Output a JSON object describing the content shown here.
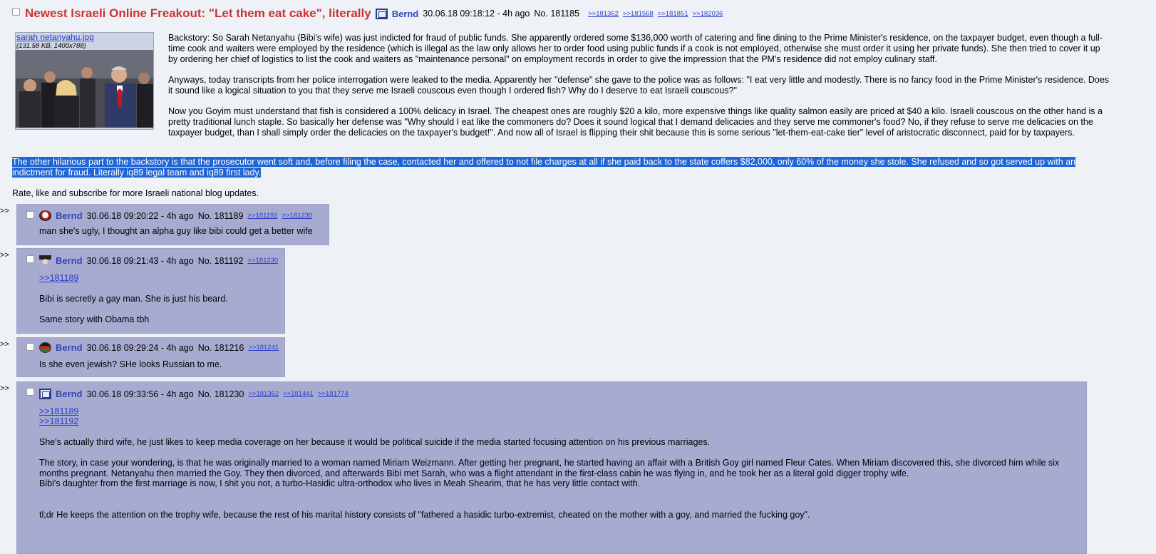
{
  "op": {
    "subject": "Newest Israeli Online Freakout: \"Let them eat cake\", literally",
    "name": "Bernd",
    "datetime": "30.06.18 09:18:12 - 4h ago",
    "number": "No. 181185",
    "backlinks": [
      ">>181362",
      ">>181568",
      ">>181851",
      ">>182036"
    ],
    "file_name": "sarah netanyahu.jpg",
    "file_info": "(131.58 KB, 1400x788)",
    "paragraphs": [
      "Backstory: So Sarah Netanyahu (Bibi's wife) was just indicted for fraud of public funds. She apparently ordered some $136,000 worth of catering and fine dining to the Prime Minister's residence, on the taxpayer budget, even though a full-time cook and waiters were employed by the residence (which is illegal as the law only allows her to order food using public funds if a cook is not employed, otherwise she must order it using her private funds). She then tried to cover it up by ordering her chief of logistics to list the cook and waiters as \"maintenance personal\" on employment records in order to give the impression that the PM's residence did not employ culinary staff.",
      "Anyways, today transcripts from her police interrogation were leaked to the media. Apparently her \"defense\" she gave to the police was as follows: \"I eat very little and modestly. There is no fancy food in the Prime Minister's residence. Does it sound like a logical situation to you that they serve me Israeli couscous even though I ordered fish? Why do I deserve to eat Israeli couscous?\"",
      "Now you Goyim must understand that fish is considered a 100% delicacy in Israel. The cheapest ones are roughly $20 a kilo, more expensive things like quality salmon easily are priced at $40 a kilo. Israeli couscous on the other hand is a pretty traditional lunch staple. So basically her defense was \"Why should I eat like the commoners do? Does it sound logical that I demand delicacies and they serve me commoner's food? No, if they refuse to serve me delicacies on the taxpayer budget, than I shall simply order the delicacies on the taxpayer's budget!\". And now all of Israel is flipping their shit because this is some serious \"let-them-eat-cake tier\" level of aristocratic disconnect, paid for by taxpayers."
    ],
    "highlighted": "The other hilarious part to the backstory is that the prosecutor went soft and, before filing the case, contacted her and offered to not file charges at all if she paid back to the state coffers $82,000, only 60% of the money she stole. She refused and so got served up with an indictment for fraud. Literally iq89 legal team and iq89 first lady.",
    "closing": "Rate, like and subscribe for more Israeli national blog updates."
  },
  "arrow": ">>",
  "replies": [
    {
      "name": "Bernd",
      "datetime": "30.06.18 09:20:22 - 4h ago",
      "number": "No. 181189",
      "backlinks": [
        ">>181192",
        ">>181230"
      ],
      "quotes": [],
      "paragraphs": [
        "man she's ugly, I thought an alpha guy like bibi could get a better wife"
      ]
    },
    {
      "name": "Bernd",
      "datetime": "30.06.18 09:21:43 - 4h ago",
      "number": "No. 181192",
      "backlinks": [
        ">>181230"
      ],
      "quotes": [
        ">>181189"
      ],
      "paragraphs": [
        "Bibi is secretly a gay man. She is just his beard.",
        "Same story with Obama tbh"
      ]
    },
    {
      "name": "Bernd",
      "datetime": "30.06.18 09:29:24 - 4h ago",
      "number": "No. 181216",
      "backlinks": [
        ">>181241"
      ],
      "quotes": [],
      "paragraphs": [
        "Is she even jewish? SHe looks Russian to me."
      ]
    },
    {
      "name": "Bernd",
      "datetime": "30.06.18 09:33:56 - 4h ago",
      "number": "No. 181230",
      "backlinks": [
        ">>181362",
        ">>181441",
        ">>181774"
      ],
      "quotes": [
        ">>181189",
        ">>181192"
      ],
      "paragraphs": [
        "She's actually third wife, he just likes to keep media coverage on her because it would be political suicide if the media started focusing attention on his previous marriages.",
        "The story, in case your wondering, is that he was originally married to a woman named Miriam Weizmann. After getting her pregnant, he started having an affair with a British Goy girl named Fleur Cates. When Miriam discovered this, she divorced him while six months pregnant. Netanyahu then married the Goy. They then divorced, and afterwards Bibi met Sarah, who was a flight attendant in the first-class cabin he was flying in, and he took her as a literal gold digger trophy wife.",
        "Bibi's daughter from the first marriage is now, I shit you not, a turbo-Hasidic ultra-orthodox who lives in Meah Shearim, that he has very little contact with.",
        "tl;dr He keeps the attention on the trophy wife, because the rest of his marital history consists of \"fathered a hasidic turbo-extremist, cheated on the mother with a goy, and married the fucking goy\"."
      ]
    }
  ]
}
